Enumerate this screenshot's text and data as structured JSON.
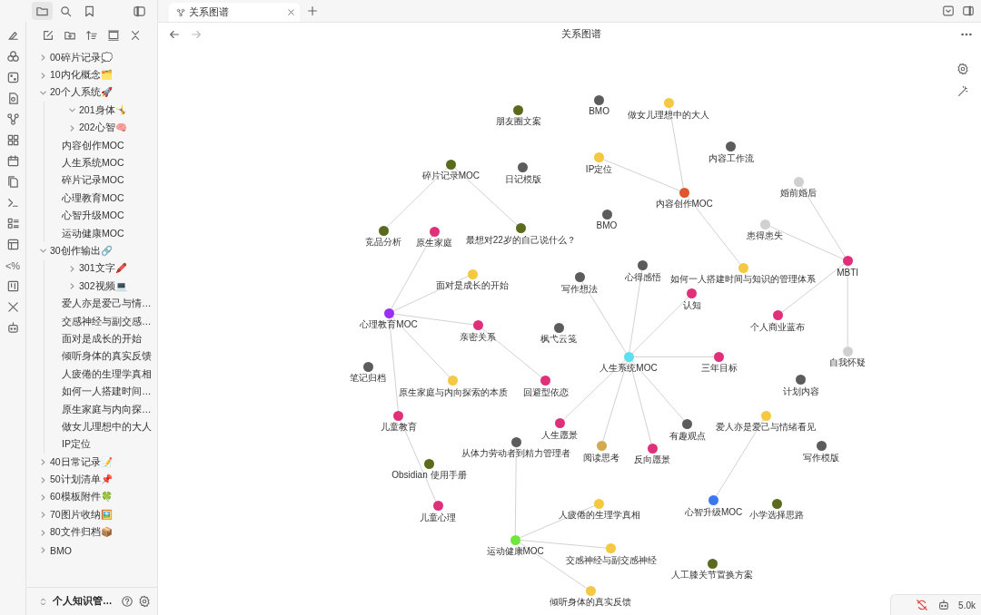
{
  "tab_bar": {
    "tabs": [
      {
        "title": "关系图谱",
        "selected": true
      }
    ]
  },
  "header": {
    "title": "关系图谱"
  },
  "ribbon": {
    "template_glyph": "<%"
  },
  "file_tree": [
    {
      "label": "00碎片记录💭",
      "kind": "folder",
      "expanded": false
    },
    {
      "label": "10内化概念🗂️",
      "kind": "folder",
      "expanded": false
    },
    {
      "label": "20个人系统🚀",
      "kind": "folder",
      "expanded": true,
      "children": [
        {
          "label": "201身体🤸",
          "kind": "folder",
          "expanded": true
        },
        {
          "label": "202心智🧠",
          "kind": "folder",
          "expanded": false
        },
        {
          "label": "内容创作MOC",
          "kind": "file"
        },
        {
          "label": "人生系统MOC",
          "kind": "file"
        },
        {
          "label": "碎片记录MOC",
          "kind": "file"
        },
        {
          "label": "心理教育MOC",
          "kind": "file"
        },
        {
          "label": "心智升级MOC",
          "kind": "file"
        },
        {
          "label": "运动健康MOC",
          "kind": "file"
        }
      ]
    },
    {
      "label": "30创作输出🔗",
      "kind": "folder",
      "expanded": true,
      "children": [
        {
          "label": "301文字🖍️",
          "kind": "folder",
          "expanded": false
        },
        {
          "label": "302视频💻",
          "kind": "folder",
          "expanded": false
        },
        {
          "label": "爱人亦是爱己与情…",
          "kind": "file"
        },
        {
          "label": "交感神经与副交感…",
          "kind": "file"
        },
        {
          "label": "面对是成长的开始",
          "kind": "file"
        },
        {
          "label": "倾听身体的真实反馈",
          "kind": "file"
        },
        {
          "label": "人疲倦的生理学真相",
          "kind": "file"
        },
        {
          "label": "如何一人搭建时间…",
          "kind": "file"
        },
        {
          "label": "原生家庭与内向探…",
          "kind": "file"
        },
        {
          "label": "做女儿理想中的大人",
          "kind": "file"
        },
        {
          "label": "IP定位",
          "kind": "file"
        }
      ]
    },
    {
      "label": "40日常记录📝",
      "kind": "folder",
      "expanded": false
    },
    {
      "label": "50计划清单📌",
      "kind": "folder",
      "expanded": false
    },
    {
      "label": "60模板附件🍀",
      "kind": "folder",
      "expanded": false
    },
    {
      "label": "70图片收纳🖼️",
      "kind": "folder",
      "expanded": false
    },
    {
      "label": "80文件归档📦",
      "kind": "folder",
      "expanded": false
    },
    {
      "label": "BMO",
      "kind": "folder",
      "expanded": false
    }
  ],
  "vault": {
    "name": "个人知识管…"
  },
  "graph": {
    "nodes": [
      {
        "label": "朋友圈文案",
        "color": "#5a6b1e"
      },
      {
        "label": "BMO",
        "color": "#5c5c5c"
      },
      {
        "label": "日记模版",
        "color": "#5c5c5c"
      },
      {
        "label": "碎片记录MOC",
        "color": "#5a6b1e",
        "children": [
          {
            "label": "竞品分析",
            "color": "#5a6b1e"
          },
          {
            "label": "最想对22岁的自己说什么？",
            "color": "#5a6b1e"
          }
        ]
      },
      {
        "label": "内容创作MOC",
        "color": "#e0562a",
        "children": [
          {
            "label": "做女儿理想中的大人",
            "color": "#f5c842"
          },
          {
            "label": "IP定位",
            "color": "#f5c842"
          },
          {
            "label": "如何一人搭建时间与知识的管理体系",
            "color": "#f5c842"
          }
        ]
      },
      {
        "label": "BMO",
        "color": "#5c5c5c"
      },
      {
        "label": "内容工作流",
        "color": "#5c5c5c"
      },
      {
        "label": "MBTI",
        "color": "#e0307a",
        "children": [
          {
            "label": "婚前婚后",
            "color": "#d0d0d0"
          },
          {
            "label": "患得患失",
            "color": "#d0d0d0"
          },
          {
            "label": "个人商业蓝布",
            "color": "#e0307a"
          },
          {
            "label": "自我怀疑",
            "color": "#d0d0d0"
          }
        ]
      },
      {
        "label": "心理教育MOC",
        "color": "#9b30f0",
        "children": [
          {
            "label": "原生家庭",
            "color": "#e0307a"
          },
          {
            "label": "面对是成长的开始",
            "color": "#f5c842"
          },
          {
            "label": "亲密关系",
            "color": "#e0307a",
            "children": [
              {
                "label": "回避型依恋",
                "color": "#e0307a"
              }
            ]
          },
          {
            "label": "原生家庭与内向探索的本质",
            "color": "#f5c842"
          },
          {
            "label": "儿童教育",
            "color": "#e0307a",
            "children": [
              {
                "label": "儿童心理",
                "color": "#e0307a"
              }
            ]
          }
        ]
      },
      {
        "label": "人生系统MOC",
        "color": "#5ce0f0",
        "children": [
          {
            "label": "写作想法",
            "color": "#5c5c5c"
          },
          {
            "label": "心得感悟",
            "color": "#5c5c5c"
          },
          {
            "label": "认知",
            "color": "#e0307a"
          },
          {
            "label": "三年目标",
            "color": "#e0307a"
          },
          {
            "label": "有趣观点",
            "color": "#5c5c5c"
          },
          {
            "label": "反向愿景",
            "color": "#e0307a"
          },
          {
            "label": "阅读思考",
            "color": "#d4aa50"
          },
          {
            "label": "人生愿景",
            "color": "#e0307a"
          }
        ]
      },
      {
        "label": "枫弋云笺",
        "color": "#5c5c5c"
      },
      {
        "label": "笔记归档",
        "color": "#5c5c5c"
      },
      {
        "label": "Obsidian 使用手册",
        "color": "#5a6b1e"
      },
      {
        "label": "运动健康MOC",
        "color": "#6ee83a",
        "children": [
          {
            "label": "从体力劳动者到精力管理者",
            "color": "#5c5c5c"
          },
          {
            "label": "人疲倦的生理学真相",
            "color": "#f5c842"
          },
          {
            "label": "交感神经与副交感神经",
            "color": "#f5c842"
          },
          {
            "label": "倾听身体的真实反馈",
            "color": "#f5c842"
          }
        ]
      },
      {
        "label": "计划内容",
        "color": "#5c5c5c"
      },
      {
        "label": "写作模版",
        "color": "#5c5c5c"
      },
      {
        "label": "心智升级MOC",
        "color": "#3a78f0",
        "children": [
          {
            "label": "爱人亦是爱己与情绪看见",
            "color": "#f5c842"
          }
        ]
      },
      {
        "label": "小学选择思路",
        "color": "#5a6b1e"
      },
      {
        "label": "人工膝关节置换方案",
        "color": "#5a6b1e"
      }
    ]
  },
  "status_bar": {
    "word_count": "5.0k"
  }
}
